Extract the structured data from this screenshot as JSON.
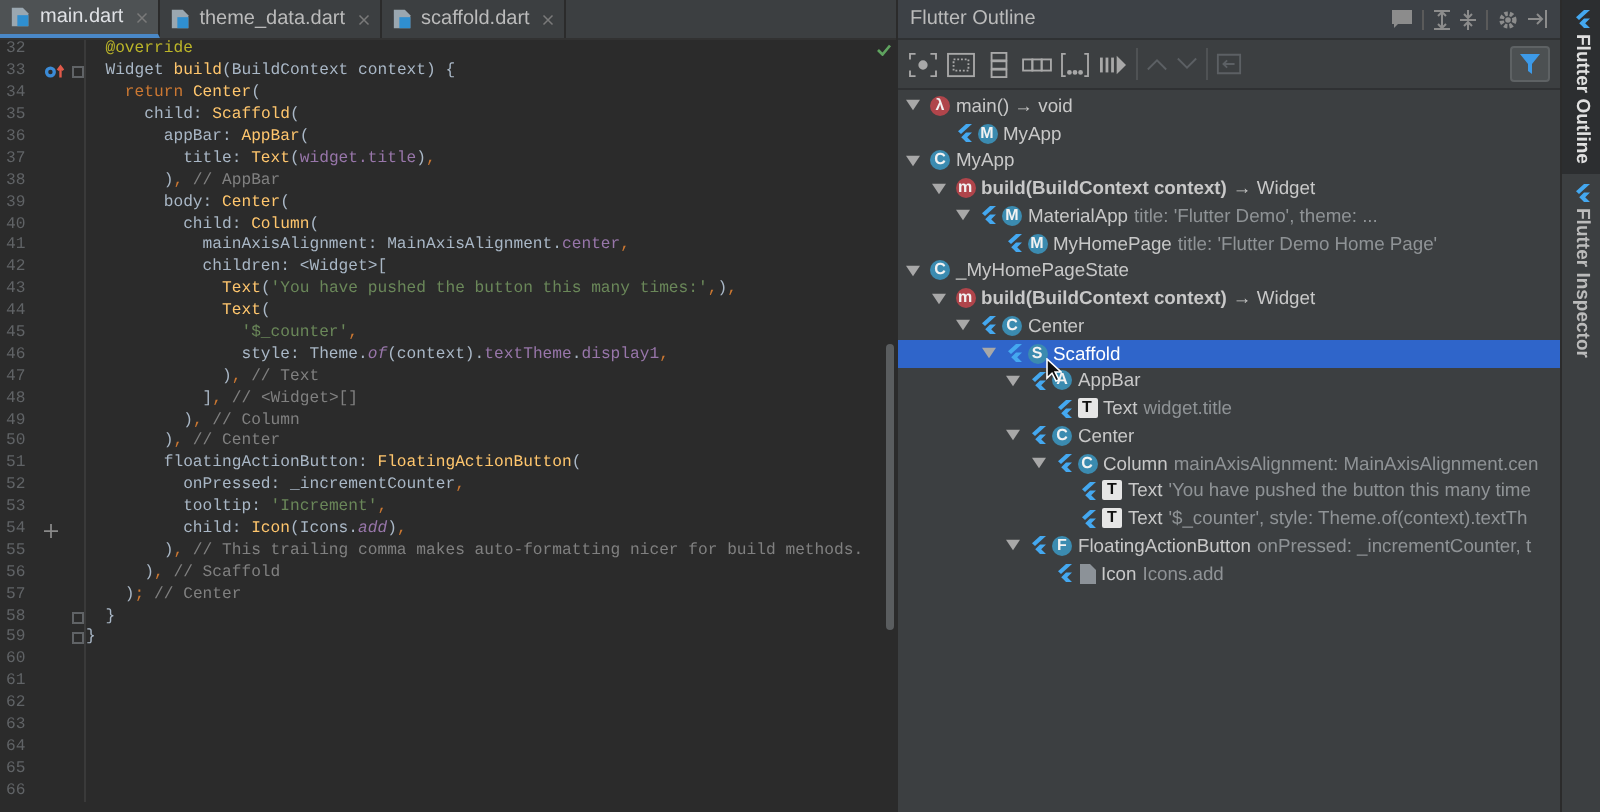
{
  "editor": {
    "tabs": [
      {
        "label": "main.dart",
        "selected": true
      },
      {
        "label": "theme_data.dart",
        "selected": false
      },
      {
        "label": "scaffold.dart",
        "selected": false
      }
    ],
    "lines": [
      {
        "number": "32",
        "tokens": [
          {
            "kind": "annotation",
            "text": "  @override"
          }
        ]
      },
      {
        "number": "33",
        "override_marker": true,
        "fold": true,
        "tokens": [
          {
            "kind": "plain",
            "text": "  Widget "
          },
          {
            "kind": "call",
            "text": "build"
          },
          {
            "kind": "plain",
            "text": "(BuildContext context) {"
          }
        ]
      },
      {
        "number": "34",
        "tokens": [
          {
            "kind": "keyword",
            "text": "    return "
          },
          {
            "kind": "call",
            "text": "Center"
          },
          {
            "kind": "plain",
            "text": "("
          }
        ]
      },
      {
        "number": "35",
        "tokens": [
          {
            "kind": "plain",
            "text": "      child: "
          },
          {
            "kind": "call",
            "text": "Scaffold"
          },
          {
            "kind": "plain",
            "text": "("
          }
        ]
      },
      {
        "number": "36",
        "tokens": [
          {
            "kind": "plain",
            "text": "        appBar: "
          },
          {
            "kind": "call",
            "text": "AppBar"
          },
          {
            "kind": "plain",
            "text": "("
          }
        ]
      },
      {
        "number": "37",
        "tokens": [
          {
            "kind": "plain",
            "text": "          title: "
          },
          {
            "kind": "call",
            "text": "Text"
          },
          {
            "kind": "plain",
            "text": "("
          },
          {
            "kind": "field",
            "text": "widget.title"
          },
          {
            "kind": "plain",
            "text": ")"
          },
          {
            "kind": "keyword",
            "text": ","
          }
        ]
      },
      {
        "number": "38",
        "tokens": [
          {
            "kind": "plain",
            "text": "        )"
          },
          {
            "kind": "keyword",
            "text": ","
          },
          {
            "kind": "comment",
            "text": " // AppBar"
          }
        ]
      },
      {
        "number": "39",
        "tokens": [
          {
            "kind": "plain",
            "text": "        body: "
          },
          {
            "kind": "call",
            "text": "Center"
          },
          {
            "kind": "plain",
            "text": "("
          }
        ]
      },
      {
        "number": "40",
        "tokens": [
          {
            "kind": "plain",
            "text": "          child: "
          },
          {
            "kind": "call",
            "text": "Column"
          },
          {
            "kind": "plain",
            "text": "("
          }
        ]
      },
      {
        "number": "41",
        "tokens": [
          {
            "kind": "plain",
            "text": "            mainAxisAlignment: MainAxisAlignment."
          },
          {
            "kind": "field",
            "text": "center"
          },
          {
            "kind": "keyword",
            "text": ","
          }
        ]
      },
      {
        "number": "42",
        "tokens": [
          {
            "kind": "plain",
            "text": "            children: <Widget>["
          }
        ]
      },
      {
        "number": "43",
        "tokens": [
          {
            "kind": "call",
            "text": "              Text"
          },
          {
            "kind": "plain",
            "text": "("
          },
          {
            "kind": "string",
            "text": "'You have pushed the button this many times:'"
          },
          {
            "kind": "keyword",
            "text": ","
          },
          {
            "kind": "plain",
            "text": ")"
          },
          {
            "kind": "keyword",
            "text": ","
          }
        ]
      },
      {
        "number": "44",
        "tokens": [
          {
            "kind": "call",
            "text": "              Text"
          },
          {
            "kind": "plain",
            "text": "("
          }
        ]
      },
      {
        "number": "45",
        "tokens": [
          {
            "kind": "string",
            "text": "                '$_counter'"
          },
          {
            "kind": "keyword",
            "text": ","
          }
        ]
      },
      {
        "number": "46",
        "tokens": [
          {
            "kind": "plain",
            "text": "                style: Theme."
          },
          {
            "kind": "static",
            "text": "of"
          },
          {
            "kind": "plain",
            "text": "(context)."
          },
          {
            "kind": "field",
            "text": "textTheme"
          },
          {
            "kind": "plain",
            "text": "."
          },
          {
            "kind": "field",
            "text": "display1"
          },
          {
            "kind": "keyword",
            "text": ","
          }
        ]
      },
      {
        "number": "47",
        "tokens": [
          {
            "kind": "plain",
            "text": "              )"
          },
          {
            "kind": "keyword",
            "text": ","
          },
          {
            "kind": "comment",
            "text": " // Text"
          }
        ]
      },
      {
        "number": "48",
        "tokens": [
          {
            "kind": "plain",
            "text": "            ]"
          },
          {
            "kind": "keyword",
            "text": ","
          },
          {
            "kind": "comment",
            "text": " // <Widget>[]"
          }
        ]
      },
      {
        "number": "49",
        "tokens": [
          {
            "kind": "plain",
            "text": "          )"
          },
          {
            "kind": "keyword",
            "text": ","
          },
          {
            "kind": "comment",
            "text": " // Column"
          }
        ]
      },
      {
        "number": "50",
        "tokens": [
          {
            "kind": "plain",
            "text": "        )"
          },
          {
            "kind": "keyword",
            "text": ","
          },
          {
            "kind": "comment",
            "text": " // Center"
          }
        ]
      },
      {
        "number": "51",
        "tokens": [
          {
            "kind": "plain",
            "text": "        floatingActionButton: "
          },
          {
            "kind": "call",
            "text": "FloatingActionButton"
          },
          {
            "kind": "plain",
            "text": "("
          }
        ]
      },
      {
        "number": "52",
        "tokens": [
          {
            "kind": "plain",
            "text": "          onPressed: _incrementCounter"
          },
          {
            "kind": "keyword",
            "text": ","
          }
        ]
      },
      {
        "number": "53",
        "tokens": [
          {
            "kind": "plain",
            "text": "          tooltip: "
          },
          {
            "kind": "string",
            "text": "'Increment'"
          },
          {
            "kind": "keyword",
            "text": ","
          }
        ]
      },
      {
        "number": "54",
        "added": true,
        "tokens": [
          {
            "kind": "plain",
            "text": "          child: "
          },
          {
            "kind": "call",
            "text": "Icon"
          },
          {
            "kind": "plain",
            "text": "(Icons."
          },
          {
            "kind": "static",
            "text": "add"
          },
          {
            "kind": "plain",
            "text": ")"
          },
          {
            "kind": "keyword",
            "text": ","
          }
        ]
      },
      {
        "number": "55",
        "tokens": [
          {
            "kind": "plain",
            "text": "        )"
          },
          {
            "kind": "keyword",
            "text": ","
          },
          {
            "kind": "comment",
            "text": " // This trailing comma makes auto-formatting nicer for build methods."
          }
        ]
      },
      {
        "number": "56",
        "tokens": [
          {
            "kind": "plain",
            "text": "      )"
          },
          {
            "kind": "keyword",
            "text": ","
          },
          {
            "kind": "comment",
            "text": " // Scaffold"
          }
        ]
      },
      {
        "number": "57",
        "tokens": [
          {
            "kind": "plain",
            "text": "    )"
          },
          {
            "kind": "keyword",
            "text": ";"
          },
          {
            "kind": "comment",
            "text": " // Center"
          }
        ]
      },
      {
        "number": "58",
        "fold": true,
        "tokens": [
          {
            "kind": "plain",
            "text": "  }"
          }
        ]
      },
      {
        "number": "59",
        "fold": true,
        "tokens": [
          {
            "kind": "plain",
            "text": "}"
          }
        ]
      },
      {
        "number": "60"
      },
      {
        "number": "61"
      },
      {
        "number": "62"
      },
      {
        "number": "63"
      },
      {
        "number": "64"
      },
      {
        "number": "65"
      },
      {
        "number": "66"
      }
    ]
  },
  "outline": {
    "title": "Flutter Outline",
    "items": [
      {
        "kind": "function",
        "badge": "λ",
        "label": "main() → void",
        "selected": false,
        "expanded": true,
        "children": [
          {
            "kind": "class",
            "flutter": true,
            "badge": "M",
            "label": "MyApp",
            "selected": false
          }
        ]
      },
      {
        "kind": "class",
        "badge": "C",
        "label": "MyApp",
        "selected": false,
        "expanded": true,
        "children": [
          {
            "kind": "method",
            "badge": "m",
            "label": "build(BuildContext context)",
            "bold": true,
            "suffix": "→ Widget",
            "selected": false,
            "expanded": true,
            "children": [
              {
                "kind": "class",
                "flutter": true,
                "badge": "M",
                "label": "MaterialApp",
                "detail": "title: 'Flutter Demo', theme: ...",
                "selected": false,
                "expanded": true,
                "children": [
                  {
                    "kind": "class",
                    "flutter": true,
                    "badge": "M",
                    "label": "MyHomePage",
                    "detail": "title: 'Flutter Demo Home Page'",
                    "selected": false
                  }
                ]
              }
            ]
          }
        ]
      },
      {
        "kind": "class",
        "badge": "C",
        "label": "_MyHomePageState",
        "selected": false,
        "expanded": true,
        "children": [
          {
            "kind": "method",
            "badge": "m",
            "label": "build(BuildContext context)",
            "bold": true,
            "suffix": "→ Widget",
            "selected": false,
            "expanded": true,
            "children": [
              {
                "kind": "class",
                "flutter": true,
                "badge": "C",
                "label": "Center",
                "selected": false,
                "expanded": true,
                "children": [
                  {
                    "kind": "class",
                    "flutter": true,
                    "badge": "S",
                    "label": "Scaffold",
                    "selected": true,
                    "expanded": true,
                    "children": [
                      {
                        "kind": "class",
                        "flutter": true,
                        "badge": "A",
                        "label": "AppBar",
                        "selected": false,
                        "expanded": true,
                        "children": [
                          {
                            "kind": "text",
                            "flutter": true,
                            "badge": "T",
                            "label": "Text",
                            "detail": "widget.title",
                            "selected": false
                          }
                        ]
                      },
                      {
                        "kind": "class",
                        "flutter": true,
                        "badge": "C",
                        "label": "Center",
                        "selected": false,
                        "expanded": true,
                        "children": [
                          {
                            "kind": "class",
                            "flutter": true,
                            "badge": "C",
                            "label": "Column",
                            "detail": "mainAxisAlignment: MainAxisAlignment.cen",
                            "selected": false,
                            "expanded": true,
                            "children": [
                              {
                                "kind": "text",
                                "flutter": true,
                                "badge": "T",
                                "label": "Text",
                                "detail": "'You have pushed the button this many time",
                                "selected": false
                              },
                              {
                                "kind": "text",
                                "flutter": true,
                                "badge": "T",
                                "label": "Text",
                                "detail": "'$_counter', style: Theme.of(context).textTh",
                                "selected": false
                              }
                            ]
                          }
                        ]
                      },
                      {
                        "kind": "class",
                        "flutter": true,
                        "badge": "F",
                        "label": "FloatingActionButton",
                        "detail": "onPressed: _incrementCounter, t",
                        "selected": false,
                        "expanded": true,
                        "children": [
                          {
                            "kind": "doc",
                            "flutter": true,
                            "label": "Icon",
                            "detail": "Icons.add",
                            "selected": false
                          }
                        ]
                      }
                    ]
                  }
                ]
              }
            ]
          }
        ]
      }
    ]
  },
  "side_tabs": [
    {
      "label": "Flutter Outline",
      "selected": true
    },
    {
      "label": "Flutter Inspector",
      "selected": false
    }
  ]
}
